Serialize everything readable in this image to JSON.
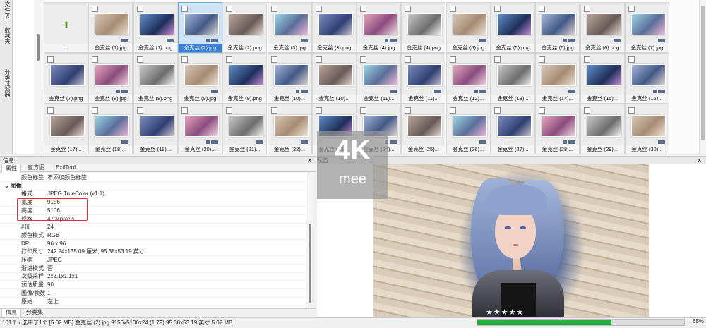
{
  "sidebar": {
    "vertical_tabs": [
      "文件夹",
      "收藏夹",
      "分类过滤器"
    ]
  },
  "grid": {
    "parent_label": "..",
    "items": [
      "金克丝 (1).jpg",
      "金克丝 (1).png",
      "金克丝 (2).jpg",
      "金克丝 (2).png",
      "金克丝 (3).jpg",
      "金克丝 (3).png",
      "金克丝 (4).jpg",
      "金克丝 (4).png",
      "金克丝 (5).jpg",
      "金克丝 (5).png",
      "金克丝 (6).jpg",
      "金克丝 (6).png",
      "金克丝 (7).jpg",
      "金克丝 (7).png",
      "金克丝 (8).jpg",
      "金克丝 (8).png",
      "金克丝 (9).jpg",
      "金克丝 (9).png",
      "金克丝 (10)...",
      "金克丝 (10)...",
      "金克丝 (11)...",
      "金克丝 (11)...",
      "金克丝 (12)...",
      "金克丝 (13)...",
      "金克丝 (14)...",
      "金克丝 (15)...",
      "金克丝 (16)...",
      "金克丝 (17)...",
      "金克丝 (18)...",
      "金克丝 (19)...",
      "金克丝 (20)...",
      "金克丝 (21)...",
      "金克丝 (22)...",
      "金克丝 (23)...",
      "金克丝 (24)...",
      "金克丝 (25)...",
      "金克丝 (26)...",
      "金克丝 (27)...",
      "金克丝 (28)...",
      "金克丝 (29)...",
      "金克丝 (30)..."
    ],
    "selected": "金克丝 (2).jpg"
  },
  "info_panel": {
    "title": "信息",
    "close": "✕",
    "tabs": [
      "属性",
      "直方图",
      "ExifTool"
    ],
    "rows": [
      {
        "k": "颜色标签",
        "v": "不添加颜色标签"
      },
      {
        "k": "图像",
        "v": "",
        "section": true
      },
      {
        "k": "格式",
        "v": "JPEG TrueColor (v1.1)"
      },
      {
        "k": "宽度",
        "v": "9156"
      },
      {
        "k": "高度",
        "v": "5106"
      },
      {
        "k": "规格",
        "v": "47 Mpixels"
      },
      {
        "k": "#位",
        "v": "24"
      },
      {
        "k": "颜色模式",
        "v": "RGB"
      },
      {
        "k": "DPI",
        "v": "96 x 96"
      },
      {
        "k": "打印尺寸",
        "v": "242.24x135.09 厘米, 95.38x53.19 英寸"
      },
      {
        "k": "压缩",
        "v": "JPEG"
      },
      {
        "k": "渐进模式",
        "v": "否"
      },
      {
        "k": "次级采样",
        "v": "2x2,1x1,1x1"
      },
      {
        "k": "预估质量",
        "v": "90"
      },
      {
        "k": "图像/帧数",
        "v": "1"
      },
      {
        "k": "原始",
        "v": "左上"
      }
    ],
    "bottom_tabs": [
      "信息",
      "分类集"
    ]
  },
  "preview": {
    "title": "预览",
    "close": "✕",
    "stars": "★★★★★"
  },
  "watermark": {
    "big": "4K",
    "small": "mee"
  },
  "status": {
    "text": "101个 / 选中了1个 [5.02 MB]  金克丝 (2).jpg  9156x5106x24 (1.79)  95.38x53.19 英寸  5.02 MB",
    "progress": 0.65,
    "zoom": "65%"
  }
}
